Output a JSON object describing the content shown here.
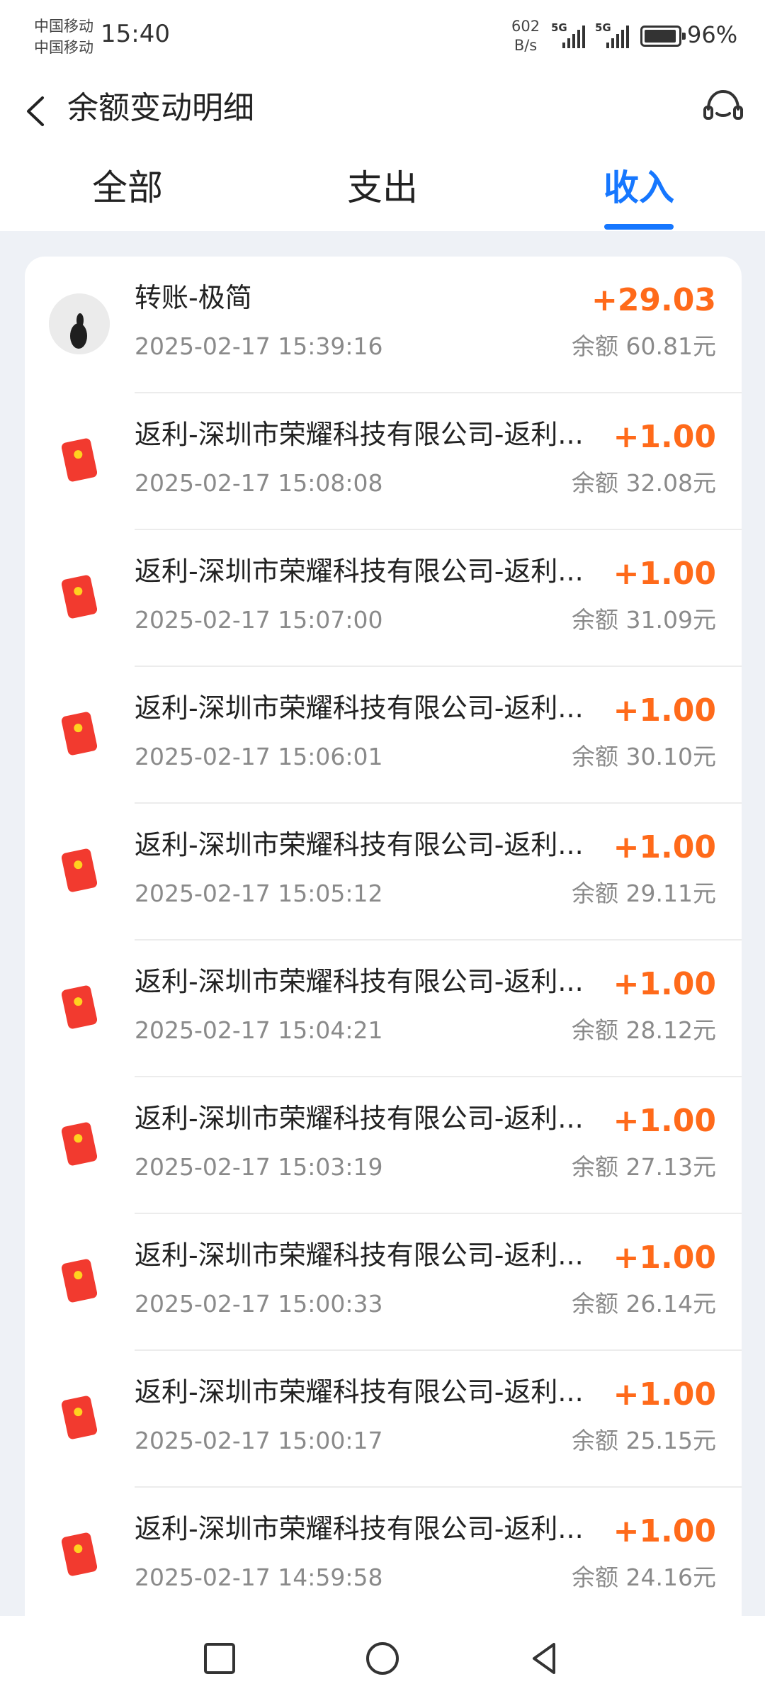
{
  "status_bar": {
    "carrier_1": "中国移动",
    "carrier_2": "中国移动",
    "time": "15:40",
    "net_speed_value": "602",
    "net_speed_unit": "B/s",
    "signal_1_label": "5G",
    "signal_2_label": "5G",
    "battery": "96%"
  },
  "header": {
    "title": "余额变动明细",
    "back_icon": "chevron-left-icon",
    "service_icon": "headset-icon"
  },
  "tabs": [
    {
      "label": "全部",
      "active": false
    },
    {
      "label": "支出",
      "active": false
    },
    {
      "label": "收入",
      "active": true
    }
  ],
  "transactions": [
    {
      "title": "转账-极简",
      "date": "2025-02-17 15:39:16",
      "amount": "+29.03",
      "balance": "余额 60.81元",
      "icon": "avatar"
    },
    {
      "title": "返利-深圳市荣耀科技有限公司-返利...",
      "date": "2025-02-17 15:08:08",
      "amount": "+1.00",
      "balance": "余额 32.08元",
      "icon": "red-packet-icon"
    },
    {
      "title": "返利-深圳市荣耀科技有限公司-返利...",
      "date": "2025-02-17 15:07:00",
      "amount": "+1.00",
      "balance": "余额 31.09元",
      "icon": "red-packet-icon"
    },
    {
      "title": "返利-深圳市荣耀科技有限公司-返利...",
      "date": "2025-02-17 15:06:01",
      "amount": "+1.00",
      "balance": "余额 30.10元",
      "icon": "red-packet-icon"
    },
    {
      "title": "返利-深圳市荣耀科技有限公司-返利...",
      "date": "2025-02-17 15:05:12",
      "amount": "+1.00",
      "balance": "余额 29.11元",
      "icon": "red-packet-icon"
    },
    {
      "title": "返利-深圳市荣耀科技有限公司-返利...",
      "date": "2025-02-17 15:04:21",
      "amount": "+1.00",
      "balance": "余额 28.12元",
      "icon": "red-packet-icon"
    },
    {
      "title": "返利-深圳市荣耀科技有限公司-返利...",
      "date": "2025-02-17 15:03:19",
      "amount": "+1.00",
      "balance": "余额 27.13元",
      "icon": "red-packet-icon"
    },
    {
      "title": "返利-深圳市荣耀科技有限公司-返利...",
      "date": "2025-02-17 15:00:33",
      "amount": "+1.00",
      "balance": "余额 26.14元",
      "icon": "red-packet-icon"
    },
    {
      "title": "返利-深圳市荣耀科技有限公司-返利...",
      "date": "2025-02-17 15:00:17",
      "amount": "+1.00",
      "balance": "余额 25.15元",
      "icon": "red-packet-icon"
    },
    {
      "title": "返利-深圳市荣耀科技有限公司-返利...",
      "date": "2025-02-17 14:59:58",
      "amount": "+1.00",
      "balance": "余额 24.16元",
      "icon": "red-packet-icon"
    }
  ],
  "colors": {
    "accent": "#1677ff",
    "amount": "#ff6a1a",
    "background": "#eef1f6"
  },
  "nav_bar": {
    "recent_icon": "square-icon",
    "home_icon": "circle-icon",
    "back_icon": "triangle-back-icon"
  }
}
